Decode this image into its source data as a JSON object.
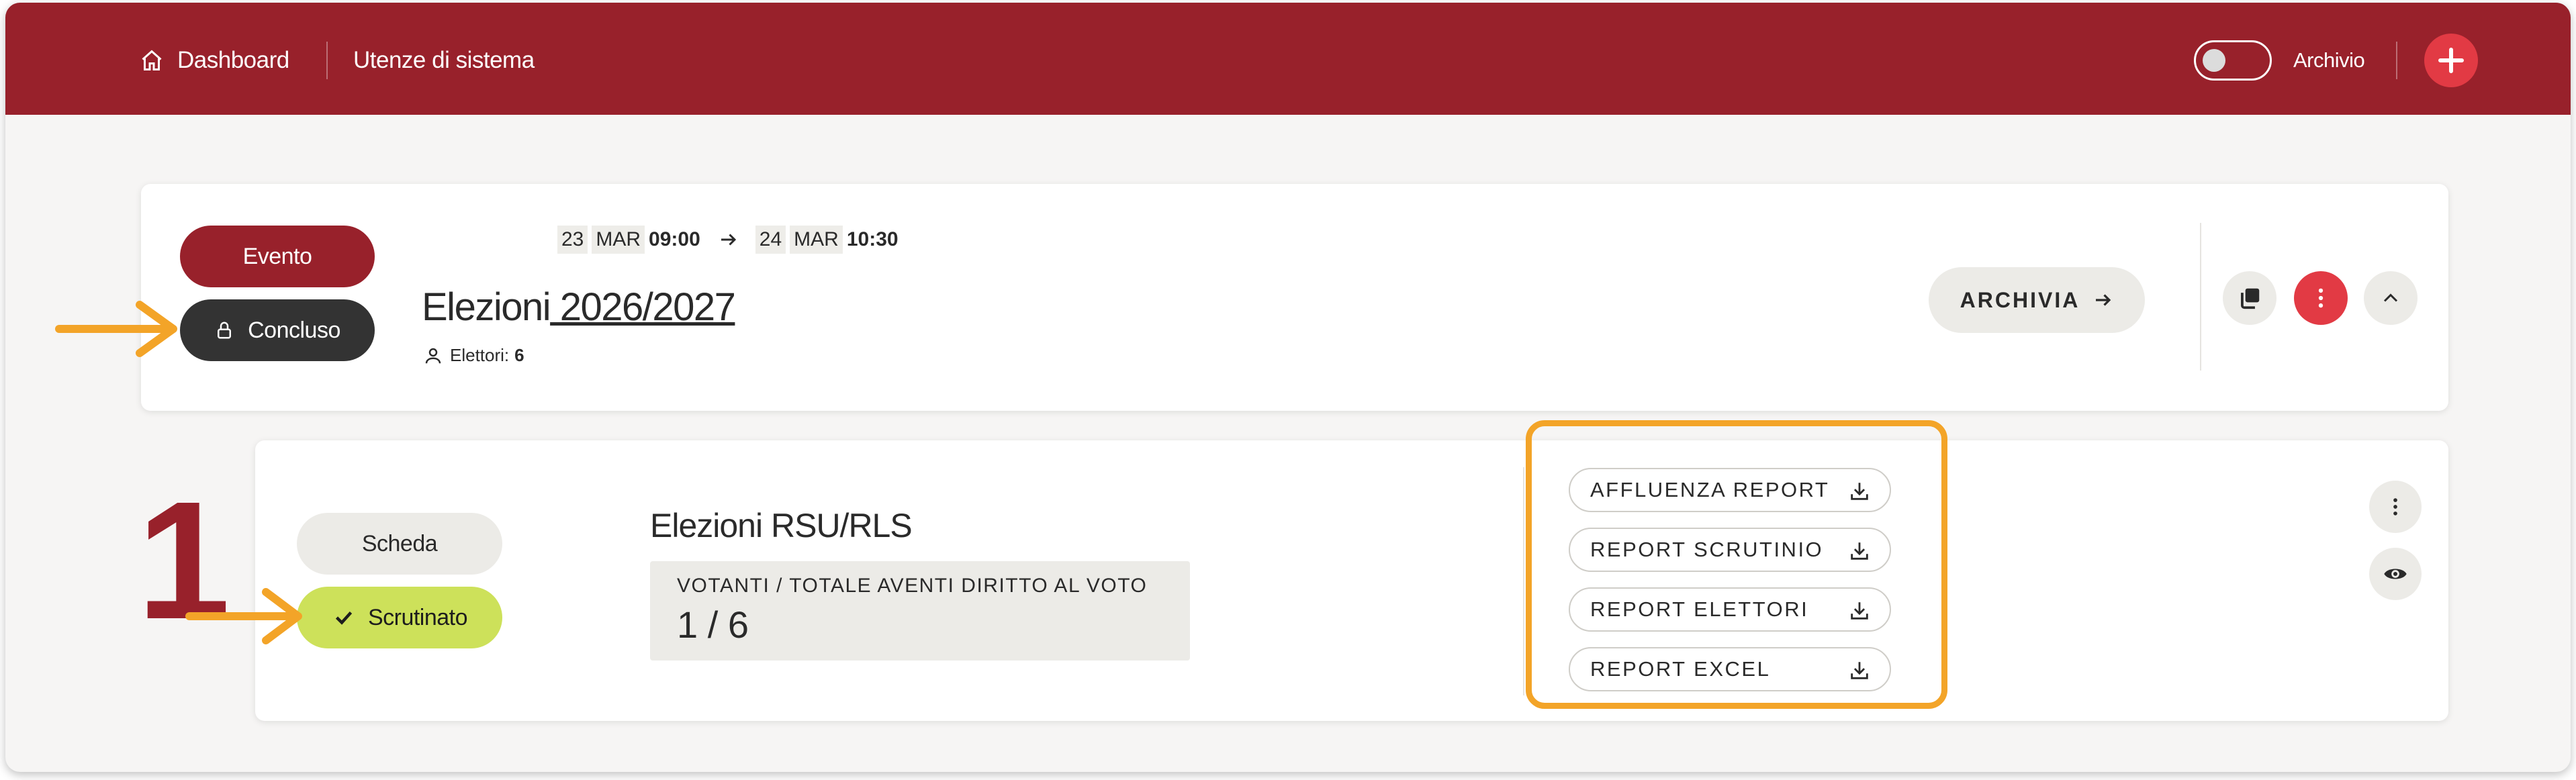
{
  "nav": {
    "dashboard": "Dashboard",
    "users": "Utenze di sistema",
    "archive_toggle_label": "Archivio"
  },
  "event": {
    "type_badge": "Evento",
    "status_badge": "Concluso",
    "start_day": "23",
    "start_month": "MAR",
    "start_time": "09:00",
    "end_day": "24",
    "end_month": "MAR",
    "end_time": "10:30",
    "title_main": "Elezioni",
    "title_link": " 2026/2027",
    "voters_label": "Elettori:",
    "voters_count": "6",
    "archive_button": "ARCHIVIA"
  },
  "ballot": {
    "type_badge": "Scheda",
    "status_badge": "Scrutinato",
    "title": "Elezioni RSU/RLS",
    "turnout_label": "VOTANTI / TOTALE AVENTI DIRITTO AL VOTO",
    "turnout_value": "1 / 6",
    "reports": [
      "AFFLUENZA REPORT",
      "REPORT SCRUTINIO",
      "REPORT ELETTORI",
      "REPORT EXCEL"
    ]
  },
  "annotations": {
    "step_number": "1"
  },
  "colors": {
    "brand": "#98212b",
    "accent_red": "#e23a44",
    "dark_badge": "#333333",
    "success": "#cde15a",
    "highlight": "#f3a428"
  },
  "icons": [
    "home-icon",
    "plus-icon",
    "lock-icon",
    "arrow-right-icon",
    "user-icon",
    "copy-icon",
    "more-vertical-icon",
    "chevron-up-icon",
    "check-icon",
    "download-icon",
    "eye-icon"
  ]
}
